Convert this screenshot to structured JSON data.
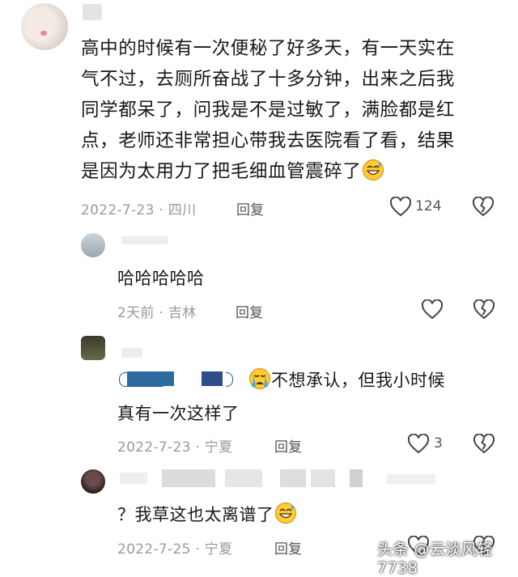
{
  "comments": [
    {
      "text_lines": [
        "高中的时候有一次便秘了好多天，有一天实在",
        "气不过，去厕所奋战了十多分钟，出来之后我",
        "同学都呆了，问我是不是过敏了，满脸都是红",
        "点，老师还非常担心带我去医院看了看，结果",
        "是因为太用力了把毛细血管震碎了"
      ],
      "date_location": "2022-7-23 · 四川",
      "reply_label": "回复",
      "like_count": "124",
      "trailing_emoji": "sweat-smile-emoji"
    },
    {
      "text": "哈哈哈哈哈",
      "date_location": "2天前 · 吉林",
      "reply_label": "回复",
      "like_count": ""
    },
    {
      "text_line1": "不想承认，但我小时候",
      "text_line2": "真有一次这样了",
      "leading_emoji": "crying-emoji",
      "date_location": "2022-7-23 · 宁夏",
      "reply_label": "回复",
      "like_count": "3"
    },
    {
      "text": "？我草这也太离谱了",
      "date_location": "2022-7-25 · 宁夏",
      "reply_label": "回复",
      "trailing_emoji": "sweat-smile-emoji"
    }
  ],
  "watermark": "头条 @云淡风轻7738",
  "colors": {
    "emoji_face": "#FFCC33",
    "emoji_outline": "#D89A1A",
    "tear": "#4AA8E8",
    "icon": "#444444",
    "meta": "#9A9A9A"
  }
}
